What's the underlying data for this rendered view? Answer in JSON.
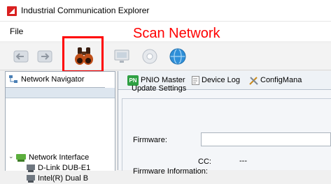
{
  "window": {
    "title": "Industrial Communication Explorer"
  },
  "menu": {
    "file_label": "File"
  },
  "annotation": {
    "callout_text": "Scan Network",
    "accent_color": "#ff0000"
  },
  "toolbar": {
    "buttons": [
      {
        "icon": "back-icon"
      },
      {
        "icon": "forward-icon"
      },
      {
        "icon": "binoculars-icon",
        "label": "Scan Network"
      },
      {
        "icon": "monitor-icon"
      },
      {
        "icon": "gear-icon"
      },
      {
        "icon": "globe-icon"
      }
    ]
  },
  "navigator": {
    "tab_label": "Network Navigator",
    "tree": {
      "root_label": "Network Interface",
      "children": [
        "D-Link DUB-E1",
        "Intel(R) Dual B"
      ]
    }
  },
  "content": {
    "tabs": [
      {
        "label": "PNIO Master",
        "badge": "PN"
      },
      {
        "label": "Device Log"
      },
      {
        "label": "ConfigMana"
      }
    ],
    "section_title": "Update Settings",
    "firmware_label": "Firmware:",
    "firmware_value": "",
    "cc_label": "CC:",
    "cc_value": "---",
    "cutoff_label": "Firmware Information:"
  }
}
